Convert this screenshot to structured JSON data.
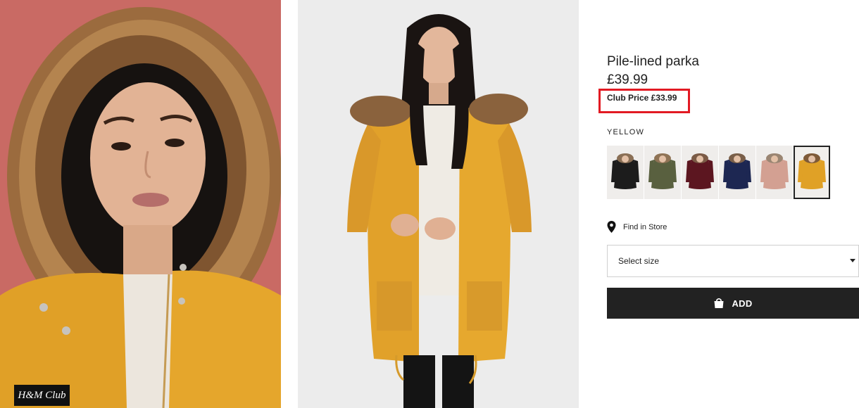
{
  "product": {
    "title": "Pile-lined parka",
    "price": "£39.99",
    "club_price": "Club Price £33.99",
    "color_name": "YELLOW"
  },
  "brand_badge": {
    "text": "H&M Club"
  },
  "swatches": [
    {
      "name": "black",
      "color": "#1c1c1c",
      "hood": "#8a6f55"
    },
    {
      "name": "khaki",
      "color": "#59603f",
      "hood": "#8f7355"
    },
    {
      "name": "burgundy",
      "color": "#5c1620",
      "hood": "#7b5b46"
    },
    {
      "name": "navy",
      "color": "#1d2752",
      "hood": "#7a5f49"
    },
    {
      "name": "pink",
      "color": "#d3a092",
      "hood": "#9a8572"
    },
    {
      "name": "yellow",
      "color": "#e0a126",
      "hood": "#7e5a38",
      "selected": true
    }
  ],
  "store": {
    "label": "Find in Store",
    "icon": "location-pin-icon"
  },
  "size_select": {
    "placeholder": "Select size"
  },
  "add_button": {
    "label": "ADD",
    "icon": "shopping-bag-icon"
  },
  "colors": {
    "accent_red": "#e21a23",
    "button_dark": "#222222",
    "parka_yellow": "#e3a12a"
  }
}
